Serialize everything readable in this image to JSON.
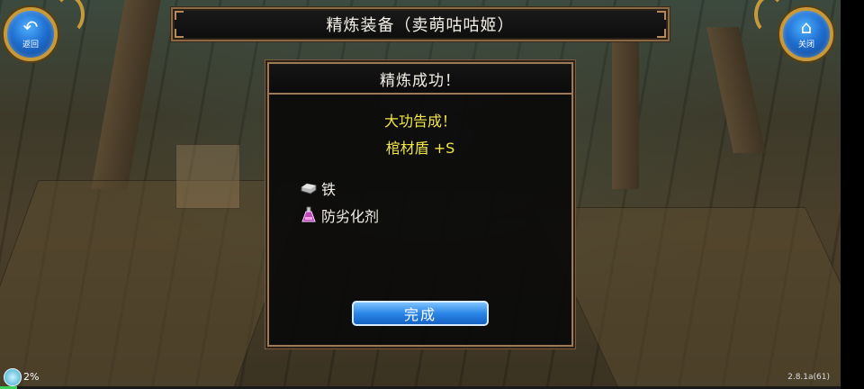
{
  "header": {
    "title": "精炼装备（卖萌咕咕姬）",
    "back_label": "返回",
    "close_label": "关闭"
  },
  "dialog": {
    "title": "精炼成功！",
    "result_line1": "大功告成！",
    "result_line2": "棺材盾 +S",
    "materials": [
      {
        "icon": "iron-ingot-icon",
        "label": "铁"
      },
      {
        "icon": "potion-icon",
        "label": "防劣化剂"
      }
    ],
    "done_label": "完成"
  },
  "status": {
    "progress_text": "2%",
    "progress_value": 0.02,
    "version": "2.8.1a(61)"
  },
  "colors": {
    "accent_yellow": "#f2e64a",
    "button_blue": "#2a86e8",
    "frame_brown": "#9b7a55"
  }
}
